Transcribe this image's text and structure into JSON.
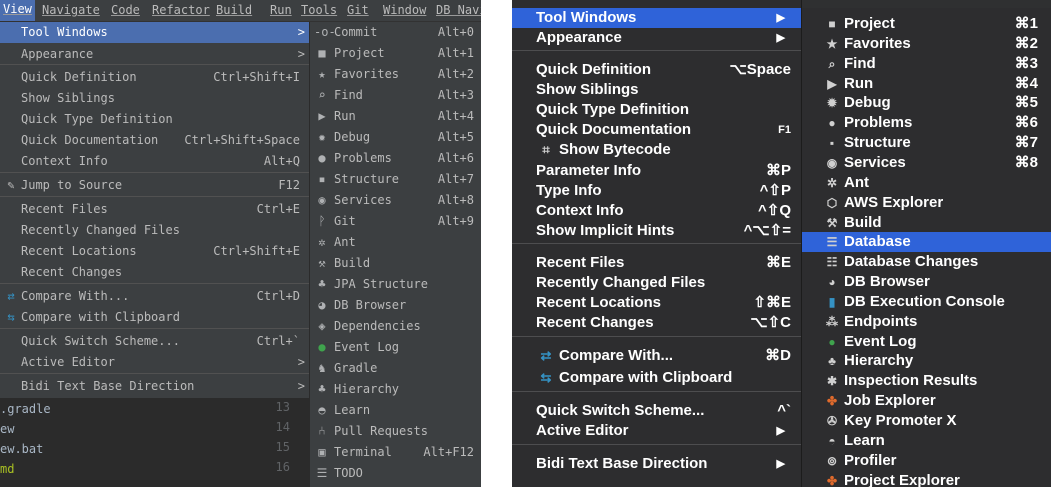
{
  "left": {
    "menubar": [
      "View",
      "Navigate",
      "Code",
      "Refactor",
      "Build",
      "Run",
      "Tools",
      "Git",
      "Window",
      "DB Navi"
    ],
    "view_menu": [
      {
        "label": "Tool Windows",
        "arrow": ">",
        "selected": true
      },
      {
        "label": "Appearance",
        "arrow": ">"
      },
      {
        "label": "Quick Definition",
        "shortcut": "Ctrl+Shift+I"
      },
      {
        "label": "Show Siblings"
      },
      {
        "label": "Quick Type Definition"
      },
      {
        "label": "Quick Documentation",
        "shortcut": "Ctrl+Shift+Space"
      },
      {
        "label": "Context Info",
        "shortcut": "Alt+Q"
      },
      {
        "label": "Jump to Source",
        "shortcut": "F12",
        "icon": "jump-to-source-icon"
      },
      {
        "label": "Recent Files",
        "shortcut": "Ctrl+E"
      },
      {
        "label": "Recently Changed Files"
      },
      {
        "label": "Recent Locations",
        "shortcut": "Ctrl+Shift+E"
      },
      {
        "label": "Recent Changes"
      },
      {
        "label": "Compare With...",
        "shortcut": "Ctrl+D",
        "icon": "compare-icon"
      },
      {
        "label": "Compare with Clipboard",
        "icon": "compare-clipboard-icon"
      },
      {
        "label": "Quick Switch Scheme...",
        "shortcut": "Ctrl+`"
      },
      {
        "label": "Active Editor",
        "arrow": ">"
      },
      {
        "label": "Bidi Text Base Direction",
        "arrow": ">"
      }
    ],
    "tool_windows": [
      {
        "label": "Commit",
        "shortcut": "Alt+0",
        "icon": "commit-icon"
      },
      {
        "label": "Project",
        "shortcut": "Alt+1",
        "icon": "folder-icon"
      },
      {
        "label": "Favorites",
        "shortcut": "Alt+2",
        "icon": "star-icon"
      },
      {
        "label": "Find",
        "shortcut": "Alt+3",
        "icon": "search-icon"
      },
      {
        "label": "Run",
        "shortcut": "Alt+4",
        "icon": "run-icon"
      },
      {
        "label": "Debug",
        "shortcut": "Alt+5",
        "icon": "bug-icon"
      },
      {
        "label": "Problems",
        "shortcut": "Alt+6",
        "icon": "problems-icon"
      },
      {
        "label": "Structure",
        "shortcut": "Alt+7",
        "icon": "structure-icon"
      },
      {
        "label": "Services",
        "shortcut": "Alt+8",
        "icon": "services-icon"
      },
      {
        "label": "Git",
        "shortcut": "Alt+9",
        "icon": "git-icon"
      },
      {
        "label": "Ant",
        "icon": "ant-icon"
      },
      {
        "label": "Build",
        "icon": "build-icon"
      },
      {
        "label": "JPA Structure",
        "icon": "jpa-icon"
      },
      {
        "label": "DB Browser",
        "icon": "db-browser-icon"
      },
      {
        "label": "Dependencies",
        "icon": "dependencies-icon"
      },
      {
        "label": "Event Log",
        "icon": "event-log-icon"
      },
      {
        "label": "Gradle",
        "icon": "gradle-icon"
      },
      {
        "label": "Hierarchy",
        "icon": "hierarchy-icon"
      },
      {
        "label": "Learn",
        "icon": "learn-icon"
      },
      {
        "label": "Pull Requests",
        "icon": "pull-requests-icon"
      },
      {
        "label": "Terminal",
        "shortcut": "Alt+F12",
        "icon": "terminal-icon"
      },
      {
        "label": "TODO",
        "icon": "todo-icon"
      }
    ],
    "project_files": [
      ".gradle",
      "ew",
      "ew.bat",
      "md"
    ],
    "line_numbers": [
      "13",
      "14",
      "15",
      "16"
    ]
  },
  "right": {
    "view_menu": [
      {
        "label": "Tool Windows",
        "arrow": "▶",
        "selected": true
      },
      {
        "label": "Appearance",
        "arrow": "▶"
      },
      {
        "label": "Quick Definition",
        "shortcut": "⌥Space"
      },
      {
        "label": "Show Siblings"
      },
      {
        "label": "Quick Type Definition"
      },
      {
        "label": "Quick Documentation",
        "shortcut": "F1"
      },
      {
        "label": "Show Bytecode",
        "icon": "bytecode-icon"
      },
      {
        "label": "Parameter Info",
        "shortcut": "⌘P"
      },
      {
        "label": "Type Info",
        "shortcut": "^⇧P"
      },
      {
        "label": "Context Info",
        "shortcut": "^⇧Q"
      },
      {
        "label": "Show Implicit Hints",
        "shortcut": "^⌥⇧="
      },
      {
        "label": "Recent Files",
        "shortcut": "⌘E"
      },
      {
        "label": "Recently Changed Files"
      },
      {
        "label": "Recent Locations",
        "shortcut": "⇧⌘E"
      },
      {
        "label": "Recent Changes",
        "shortcut": "⌥⇧C"
      },
      {
        "label": "Compare With...",
        "shortcut": "⌘D",
        "icon": "compare-icon"
      },
      {
        "label": "Compare with Clipboard",
        "icon": "compare-clipboard-icon"
      },
      {
        "label": "Quick Switch Scheme...",
        "shortcut": "^`"
      },
      {
        "label": "Active Editor",
        "arrow": "▶"
      },
      {
        "label": "Bidi Text Base Direction",
        "arrow": "▶"
      }
    ],
    "tool_windows": [
      {
        "label": "Project",
        "shortcut": "⌘1",
        "icon": "folder-icon"
      },
      {
        "label": "Favorites",
        "shortcut": "⌘2",
        "icon": "star-icon"
      },
      {
        "label": "Find",
        "shortcut": "⌘3",
        "icon": "search-icon"
      },
      {
        "label": "Run",
        "shortcut": "⌘4",
        "icon": "run-icon"
      },
      {
        "label": "Debug",
        "shortcut": "⌘5",
        "icon": "bug-icon"
      },
      {
        "label": "Problems",
        "shortcut": "⌘6",
        "icon": "problems-icon"
      },
      {
        "label": "Structure",
        "shortcut": "⌘7",
        "icon": "structure-icon"
      },
      {
        "label": "Services",
        "shortcut": "⌘8",
        "icon": "services-icon"
      },
      {
        "label": "Ant",
        "icon": "ant-icon"
      },
      {
        "label": "AWS Explorer",
        "icon": "aws-icon"
      },
      {
        "label": "Build",
        "icon": "build-icon"
      },
      {
        "label": "Database",
        "icon": "database-icon",
        "selected": true
      },
      {
        "label": "Database Changes",
        "icon": "database-changes-icon"
      },
      {
        "label": "DB Browser",
        "icon": "db-browser-icon"
      },
      {
        "label": "DB Execution Console",
        "icon": "db-console-icon"
      },
      {
        "label": "Endpoints",
        "icon": "endpoints-icon"
      },
      {
        "label": "Event Log",
        "icon": "event-log-icon"
      },
      {
        "label": "Hierarchy",
        "icon": "hierarchy-icon"
      },
      {
        "label": "Inspection Results",
        "icon": "inspection-icon"
      },
      {
        "label": "Job Explorer",
        "icon": "job-explorer-icon"
      },
      {
        "label": "Key Promoter X",
        "icon": "key-promoter-icon"
      },
      {
        "label": "Learn",
        "icon": "learn-icon"
      },
      {
        "label": "Profiler",
        "icon": "profiler-icon"
      },
      {
        "label": "Project Explorer",
        "icon": "project-explorer-icon"
      }
    ]
  },
  "colors": {
    "dark_bg": "#3c3f41",
    "selection_windows": "#4b6eaf",
    "mac_bg": "#2d2d2f",
    "selection_mac": "#2f63d9",
    "event_log_green": "#3fa34d",
    "accent_orange": "#e06a2c"
  }
}
